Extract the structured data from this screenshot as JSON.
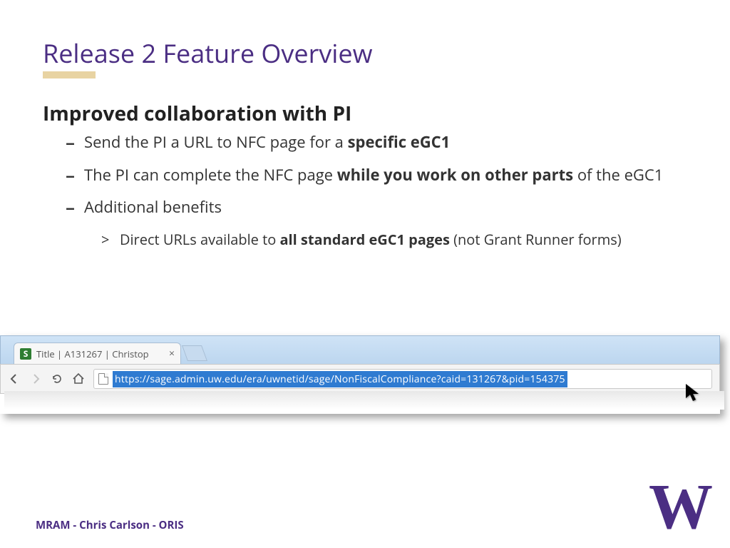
{
  "title": "Release 2 Feature Overview",
  "subhead": "Improved collaboration with PI",
  "bullets": {
    "b1a": "Send the PI a URL to NFC page for a ",
    "b1b": "specific eGC1",
    "b2a": "The PI can complete the NFC page ",
    "b2b": "while you work on other parts",
    "b2c": " of the eGC1",
    "b3": "Additional benefits",
    "b3_1a": "Direct URLs available to ",
    "b3_1b": "all standard eGC1 pages",
    "b3_1c": " (not Grant Runner forms)"
  },
  "browser": {
    "favicon_letter": "S",
    "tab_title": "Title | A131267 | Christop",
    "tab_close": "×",
    "url": "https://sage.admin.uw.edu/era/uwnetid/sage/NonFiscalCompliance?caid=131267&pid=154375"
  },
  "footer": "MRAM - Chris Carlson - ORIS",
  "logo_text": "W"
}
